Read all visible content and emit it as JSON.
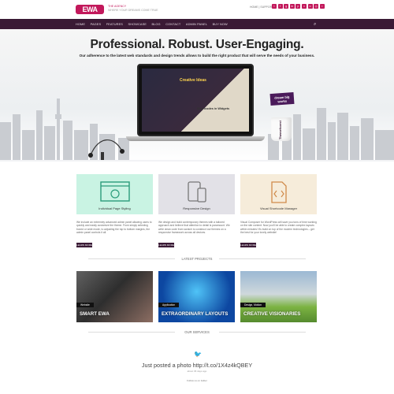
{
  "header": {
    "logo": "EWA",
    "tagline_title": "THE AGENCY",
    "tagline_sub": "WHERE YOUR DREAMS COME TRUE",
    "top_links": "HOME | SUPPORT |",
    "social_icons": [
      "twitter-icon",
      "facebook-icon",
      "google-icon",
      "linkedin-icon",
      "pinterest-icon",
      "vimeo-icon",
      "flickr-icon",
      "dribbble-icon",
      "rss-icon"
    ]
  },
  "nav": {
    "items": [
      "HOME",
      "PAGES",
      "FEATURES",
      "SHOWCASE",
      "BLOG",
      "CONTACT",
      "ADMIN PANEL",
      "BUY NOW"
    ]
  },
  "hero": {
    "headline": "Professional. Robust. User-Engaging.",
    "lead": "Our adherence to the latest web standards and design trends allows to build the right product that will serve the needs of your business.",
    "screen_title": "Creative Ideas",
    "screen_sub": "Shortcodes in Widgets",
    "sign_text": "dream big works",
    "mug_text": "Themeforest"
  },
  "features": [
    {
      "label": "Individual Page Styling",
      "desc": "We include an extremely advanced admin panel allowing users to quickly and easily customize the theme. From simply selecting boxed or wide mode, to adjusting the top to bottom margins, the admin panel controls it all.",
      "button": "LEARN MORE"
    },
    {
      "label": "Responsive Design",
      "desc": "We design and build contemporary themes with a tailored approach and believe that attention to detail is paramount. We write clean code from scratch to construct our themes on a responsive framework across all devices.",
      "button": "LEARN MORE"
    },
    {
      "label": "Visual Shortcode Manager",
      "desc": "Visual Composer for WordPress will save you tons of time working on the site content. Now you'll be able to create complex layouts within minutes! It's build on top of the modern technologies – get the best for your lovely website!",
      "button": "LEARN MORE"
    }
  ],
  "sections": {
    "latest_projects": "LATEST PROJECTS",
    "our_services": "OUR SERVICES"
  },
  "projects": [
    {
      "tag": "Website",
      "title": "SMART EWA"
    },
    {
      "tag": "Application",
      "title": "EXTRAORDINARY LAYOUTS"
    },
    {
      "tag": "Design, Motion",
      "title": "CREATIVE VISIONARIES"
    }
  ],
  "twitter": {
    "tweet": "Just posted a photo http://t.co/1X4z4kQBEY",
    "time": "about 36 days ago",
    "follow": "Follow us on twitter"
  }
}
